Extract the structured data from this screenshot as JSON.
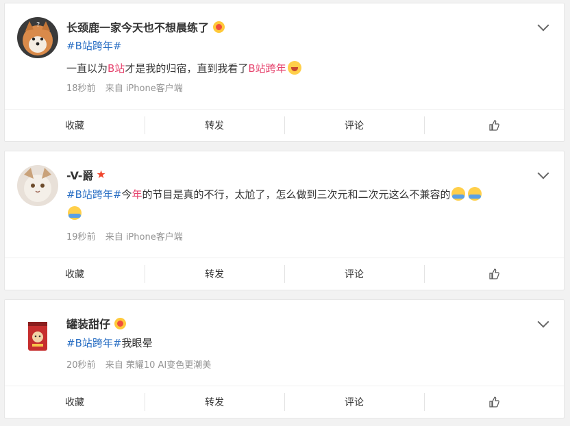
{
  "posts": [
    {
      "username": "长颈鹿一家今天也不想晨练了",
      "topic": "#B站跨年#",
      "text_parts": [
        "一直以为",
        "B站",
        "才是我的归宿，直到我看了",
        "B站跨年"
      ],
      "time": "18秒前",
      "source": "来自 iPhone客户端"
    },
    {
      "username": "-V-爵",
      "topic": "#B站跨年#",
      "text_parts": [
        "今",
        "年",
        "的节目是真的不行，太尬了，怎么做到三次元和二次元这么不兼容的"
      ],
      "time": "19秒前",
      "source": "来自 iPhone客户端"
    },
    {
      "username": "罐装甜仔",
      "topic": "#B站跨年#",
      "text_parts": [
        "我眼晕"
      ],
      "time": "20秒前",
      "source": "来自 荣耀10 AI变色更潮美"
    }
  ],
  "actions": {
    "favorite": "收藏",
    "repost": "转发",
    "comment": "评论",
    "like": "thumbs-up-icon"
  },
  "colors": {
    "topic": "#2a6fc4",
    "highlight": "#e6436d",
    "meta": "#939393",
    "background": "#f2f2f2"
  }
}
